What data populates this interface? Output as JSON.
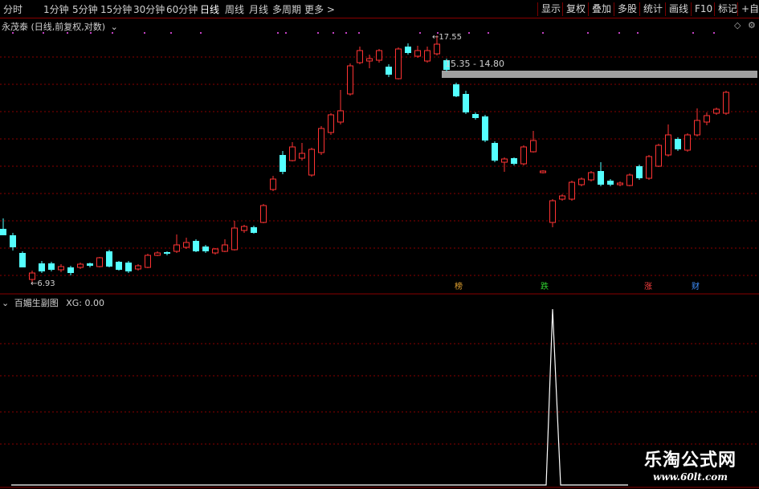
{
  "toolbar": {
    "periods": [
      "分时",
      "1分钟",
      "5分钟",
      "15分钟",
      "30分钟",
      "60分钟",
      "日线",
      "周线",
      "月线",
      "多周期",
      "更多 >"
    ],
    "active_period": "日线",
    "right_buttons": [
      "显示",
      "复权",
      "叠加",
      "多股",
      "统计",
      "画线",
      "F10",
      "标记",
      "+自选"
    ]
  },
  "main_panel": {
    "title": "永茂泰 (日线,前复权,对数)",
    "high_label": "17.55",
    "low_label": "6.93",
    "band_label": "15.35 - 14.80",
    "event_tags": [
      {
        "text": "榜",
        "color": "#e0a030"
      },
      {
        "text": "跌",
        "color": "#30d030"
      },
      {
        "text": "涨",
        "color": "#ff4040"
      },
      {
        "text": "财",
        "color": "#4090ff"
      }
    ]
  },
  "sub_panel": {
    "title": "百媚生副图",
    "indicator_label": "XG: 0.00"
  },
  "watermark": {
    "title": "乐淘公式网",
    "url": "www.60lt.com"
  },
  "colors": {
    "up": "#ff3333",
    "down": "#54ffff",
    "grid": "#8a0000",
    "band": "#a0a0a0"
  }
}
